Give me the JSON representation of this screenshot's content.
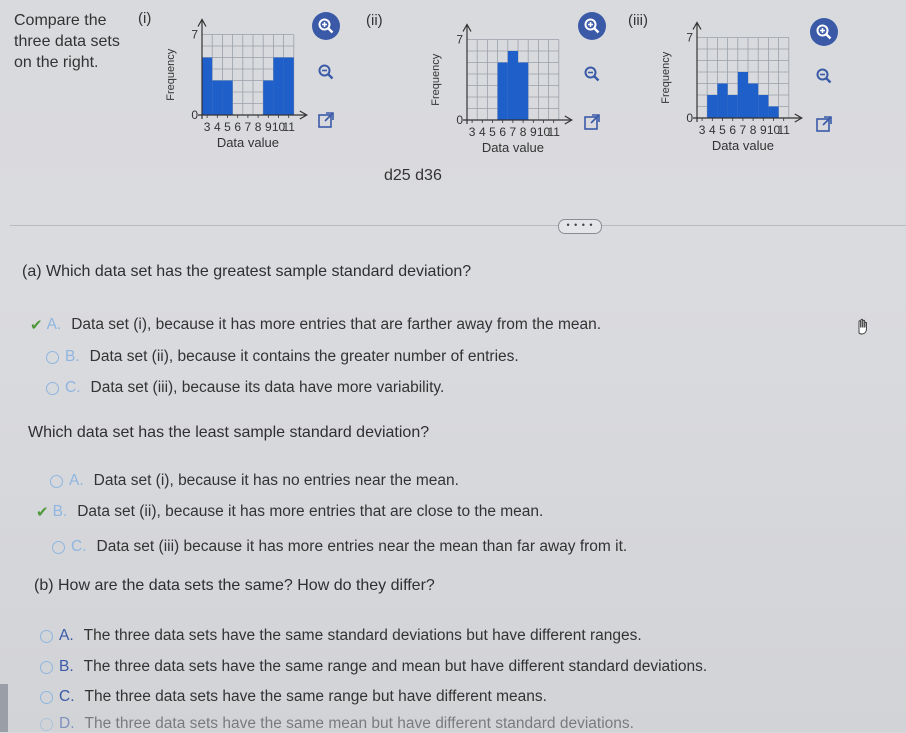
{
  "intro": {
    "line1": "Compare the",
    "line2": "three data sets",
    "line3": "on the right."
  },
  "chart_data": [
    {
      "type": "bar",
      "set_label": "(i)",
      "ylabel": "Frequency",
      "xlabel": "Data value",
      "x": [
        3,
        4,
        5,
        6,
        7,
        8,
        9,
        10,
        11
      ],
      "values": [
        5,
        3,
        3,
        0,
        0,
        0,
        3,
        5,
        5
      ],
      "ylim": [
        0,
        7
      ],
      "x_tick_labels": [
        "3",
        "4",
        "5",
        "6",
        "7",
        "8",
        "9",
        "10",
        "11"
      ],
      "y_tick_labels": [
        "0",
        "7"
      ]
    },
    {
      "type": "bar",
      "set_label": "(ii)",
      "ylabel": "Frequency",
      "xlabel": "Data value",
      "x": [
        3,
        4,
        5,
        6,
        7,
        8,
        9,
        10,
        11
      ],
      "values": [
        0,
        0,
        0,
        5,
        6,
        5,
        0,
        0,
        0
      ],
      "ylim": [
        0,
        7
      ],
      "x_tick_labels": [
        "3",
        "4",
        "5",
        "6",
        "7",
        "8",
        "9",
        "10",
        "11"
      ],
      "y_tick_labels": [
        "0",
        "7"
      ]
    },
    {
      "type": "bar",
      "set_label": "(iii)",
      "ylabel": "Frequency",
      "xlabel": "Data value",
      "x": [
        3,
        4,
        5,
        6,
        7,
        8,
        9,
        10,
        11
      ],
      "values": [
        0,
        2,
        3,
        2,
        4,
        3,
        2,
        1,
        0
      ],
      "ylim": [
        0,
        7
      ],
      "x_tick_labels": [
        "3",
        "4",
        "5",
        "6",
        "7",
        "8",
        "9",
        "10",
        "11"
      ],
      "y_tick_labels": [
        "0",
        "7"
      ]
    }
  ],
  "stray_text": "d25 d36",
  "more_button": "• • • •",
  "part_a": {
    "question1": "(a) Which data set has the greatest sample standard deviation?",
    "q1_options": [
      {
        "letter": "A.",
        "text": "Data set (i), because it has more entries that are farther away from the mean."
      },
      {
        "letter": "B.",
        "text": "Data set (ii), because it contains the greater number of entries."
      },
      {
        "letter": "C.",
        "text": "Data set (iii), because its data have more variability."
      }
    ],
    "question2": "Which data set has the least sample standard deviation?",
    "q2_options": [
      {
        "letter": "A.",
        "text": "Data set (i), because it has no entries near the mean."
      },
      {
        "letter": "B.",
        "text": "Data set (ii), because it has more entries that are close to the mean."
      },
      {
        "letter": "C.",
        "text": "Data set (iii) because it has more entries near the mean than far away from it."
      }
    ]
  },
  "part_b": {
    "question": "(b) How are the data sets the same? How do they differ?",
    "options": [
      {
        "letter": "A.",
        "text": "The three data sets have the same standard deviations but have different ranges."
      },
      {
        "letter": "B.",
        "text": "The three data sets have the same range and mean but have different standard deviations."
      },
      {
        "letter": "C.",
        "text": "The three data sets have the same range but have different means."
      },
      {
        "letter": "D.",
        "text": "The three data sets have the same mean but have different standard deviations."
      }
    ]
  },
  "colors": {
    "bar": "#1f5fc9",
    "accent": "#3a5aa8",
    "check": "#4e9a3a",
    "radio": "#8fb6e0"
  },
  "icons": [
    "zoom-in-icon",
    "zoom-out-icon",
    "external-link-icon",
    "cursor-icon"
  ]
}
